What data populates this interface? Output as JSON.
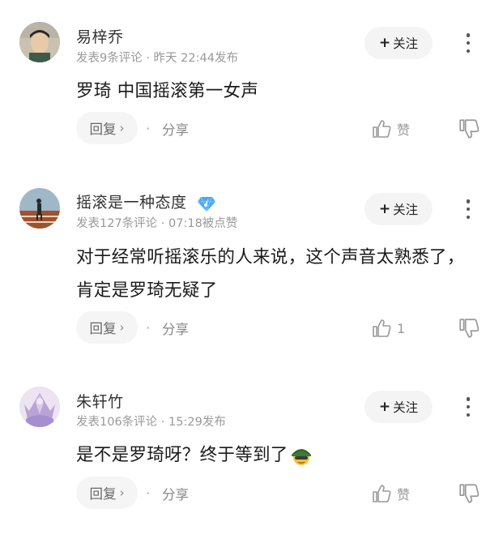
{
  "comments": [
    {
      "username": "易梓乔",
      "meta": "发表9条评论 · 昨天 22:44发布",
      "text": "罗琦 中国摇滚第一女声",
      "follow": "关注",
      "reply": "回复",
      "share": "分享",
      "like": "赞"
    },
    {
      "username": "摇滚是一种态度",
      "meta": "发表127条评论 · 07:18被点赞",
      "text": "对于经常听摇滚乐的人来说，这个声音太熟悉了，肯定是罗琦无疑了",
      "follow": "关注",
      "reply": "回复",
      "share": "分享",
      "like": "1"
    },
    {
      "username": "朱轩竹",
      "meta": "发表106条评论 · 15:29发布",
      "text": "是不是罗琦呀？终于等到了",
      "follow": "关注",
      "reply": "回复",
      "share": "分享",
      "like": "赞"
    }
  ],
  "icons": {
    "more": "more-vertical-icon",
    "like": "thumbs-up-icon",
    "dislike": "thumbs-down-icon",
    "badge": "music-diamond-icon",
    "emoji": "soldier-emoji-icon"
  },
  "colors": {
    "badge": "#4aa8f0",
    "meta": "#999999",
    "button_bg": "#f5f5f5"
  }
}
